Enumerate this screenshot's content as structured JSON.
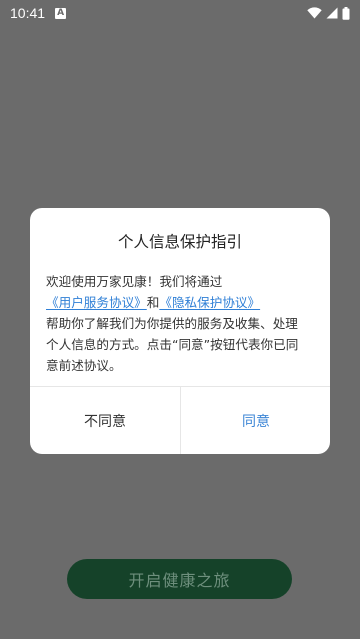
{
  "status_bar": {
    "time": "10:41",
    "notification_icon_letter": "A",
    "icons": [
      "wifi-icon",
      "signal-icon",
      "battery-icon"
    ]
  },
  "background": {
    "start_button_label": "开启健康之旅"
  },
  "dialog": {
    "title": "个人信息保护指引",
    "line1": "欢迎使用万家见康！我们将通过",
    "user_agreement_link": "《用户服务协议》",
    "and_text": "和",
    "privacy_policy_link": "《隐私保护协议》",
    "line3": "帮助你了解我们为你提供的服务及收集、处理",
    "line4": "个人信息的方式。点击“同意”按钮代表你已同",
    "line5": "意前述协议。",
    "disagree_label": "不同意",
    "agree_label": "同意"
  },
  "colors": {
    "overlay": "#6b6b6b",
    "link": "#2f7fd6",
    "agree": "#3d86d6",
    "start_button_bg": "#154229"
  }
}
